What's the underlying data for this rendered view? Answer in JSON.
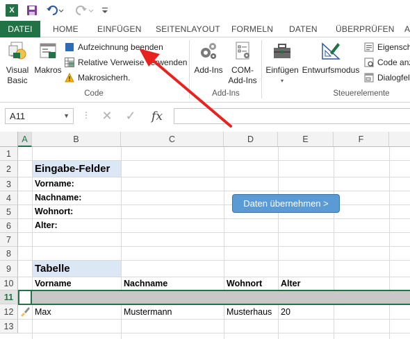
{
  "qat": {
    "app_icon": "X",
    "icons": [
      "excel-logo-icon",
      "save-icon",
      "undo-icon",
      "redo-icon",
      "customize-qat-icon"
    ]
  },
  "tabs": [
    "DATEI",
    "HOME",
    "EINFÜGEN",
    "SEITENLAYOUT",
    "FORMELN",
    "DATEN",
    "ÜBERPRÜFEN",
    "A"
  ],
  "ribbon": {
    "code": {
      "visual_basic": [
        "Visual",
        "Basic"
      ],
      "makros": "Makros",
      "aufzeichnung": "Aufzeichnung beenden",
      "relative": "Relative Verweise verwenden",
      "makrosicherheit": "Makrosicherh.",
      "label": "Code"
    },
    "addins": {
      "addins": "Add-Ins",
      "com": [
        "COM-",
        "Add-Ins"
      ],
      "label": "Add-Ins"
    },
    "controls": {
      "einfuegen": "Einfügen",
      "entwurfsmodus": "Entwurfsmodus",
      "eigenschaften": "Eigensch",
      "code_anzeigen": "Code anz",
      "dialogfeld": "Dialogfel",
      "label": "Steuerelemente"
    }
  },
  "formula_bar": {
    "name_box": "A11",
    "cancel": "✕",
    "enter": "✓",
    "fx": "fx",
    "value": ""
  },
  "sheet": {
    "columns": [
      "A",
      "B",
      "C",
      "D",
      "E",
      "F"
    ],
    "rows": [
      "1",
      "2",
      "3",
      "4",
      "5",
      "6",
      "7",
      "8",
      "9",
      "10",
      "11",
      "12",
      "13"
    ],
    "selected_row": "11",
    "selected_column": "A",
    "eingabe_title": "Eingabe-Felder",
    "fields": [
      "Vorname:",
      "Nachname:",
      "Wohnort:",
      "Alter:"
    ],
    "table_title": "Tabelle",
    "table_headers": [
      "Vorname",
      "Nachname",
      "Wohnort",
      "Alter"
    ],
    "table_row": [
      "Max",
      "Mustermann",
      "Musterhaus",
      "20"
    ],
    "button_label": "Daten übernehmen >"
  },
  "colors": {
    "excel_green": "#217346",
    "header_fill": "#dbe7f5",
    "button_blue": "#5b9bd5",
    "arrow_red": "#e8231f"
  }
}
